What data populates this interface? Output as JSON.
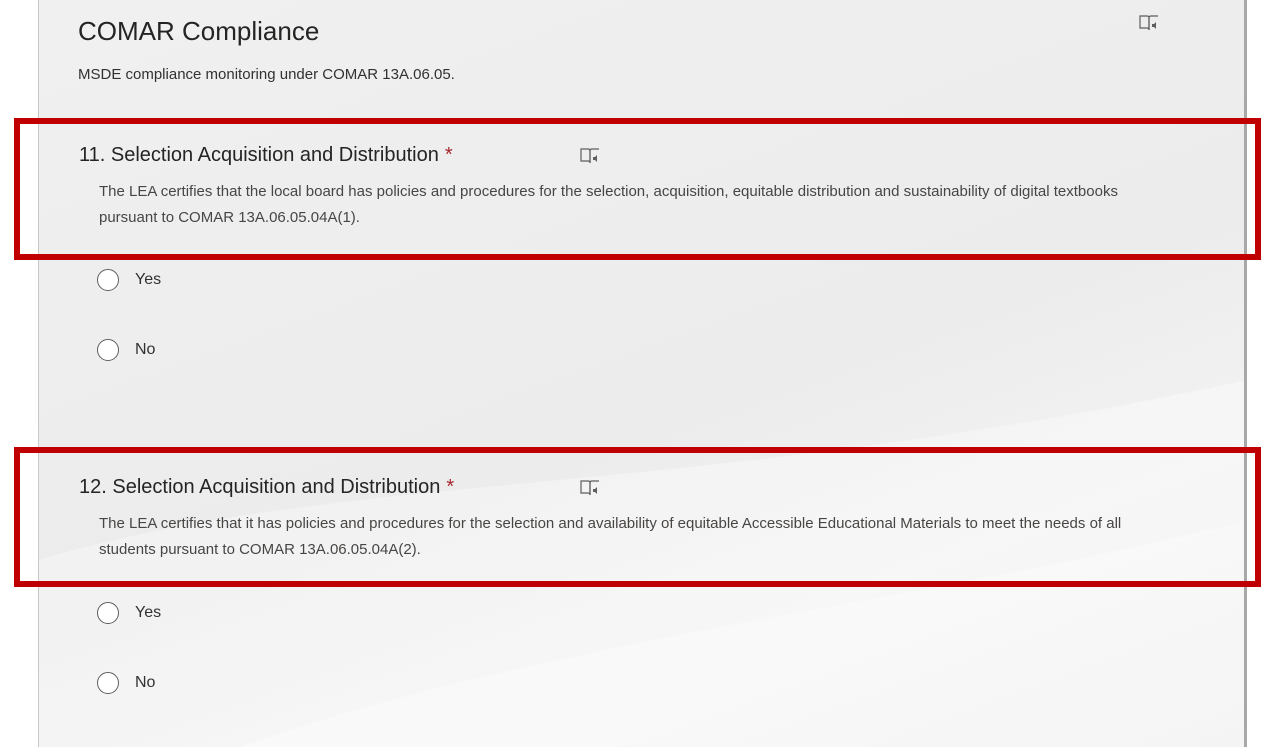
{
  "section": {
    "title": "COMAR Compliance",
    "description": "MSDE compliance monitoring under COMAR 13A.06.05.",
    "reader_icon": "immersive-reader-icon"
  },
  "questions": [
    {
      "title": "11. Selection Acquisition and Distribution",
      "required_mark": "*",
      "description": "The LEA certifies that the local board has policies and procedures for the selection, acquisition, equitable distribution and sustainability of digital textbooks pursuant to COMAR 13A.06.05.04A(1).",
      "options": [
        "Yes",
        "No"
      ],
      "reader_icon": "immersive-reader-icon"
    },
    {
      "title": "12. Selection Acquisition and Distribution",
      "required_mark": "*",
      "description": "The LEA certifies that it has policies and procedures for the selection and availability of equitable Accessible Educational Materials to meet the needs of all students pursuant to COMAR 13A.06.05.04A(2).",
      "options": [
        "Yes",
        "No"
      ],
      "reader_icon": "immersive-reader-icon"
    }
  ],
  "colors": {
    "highlight": "#c00000",
    "required": "#a4262c",
    "card_background": "#efefef"
  }
}
